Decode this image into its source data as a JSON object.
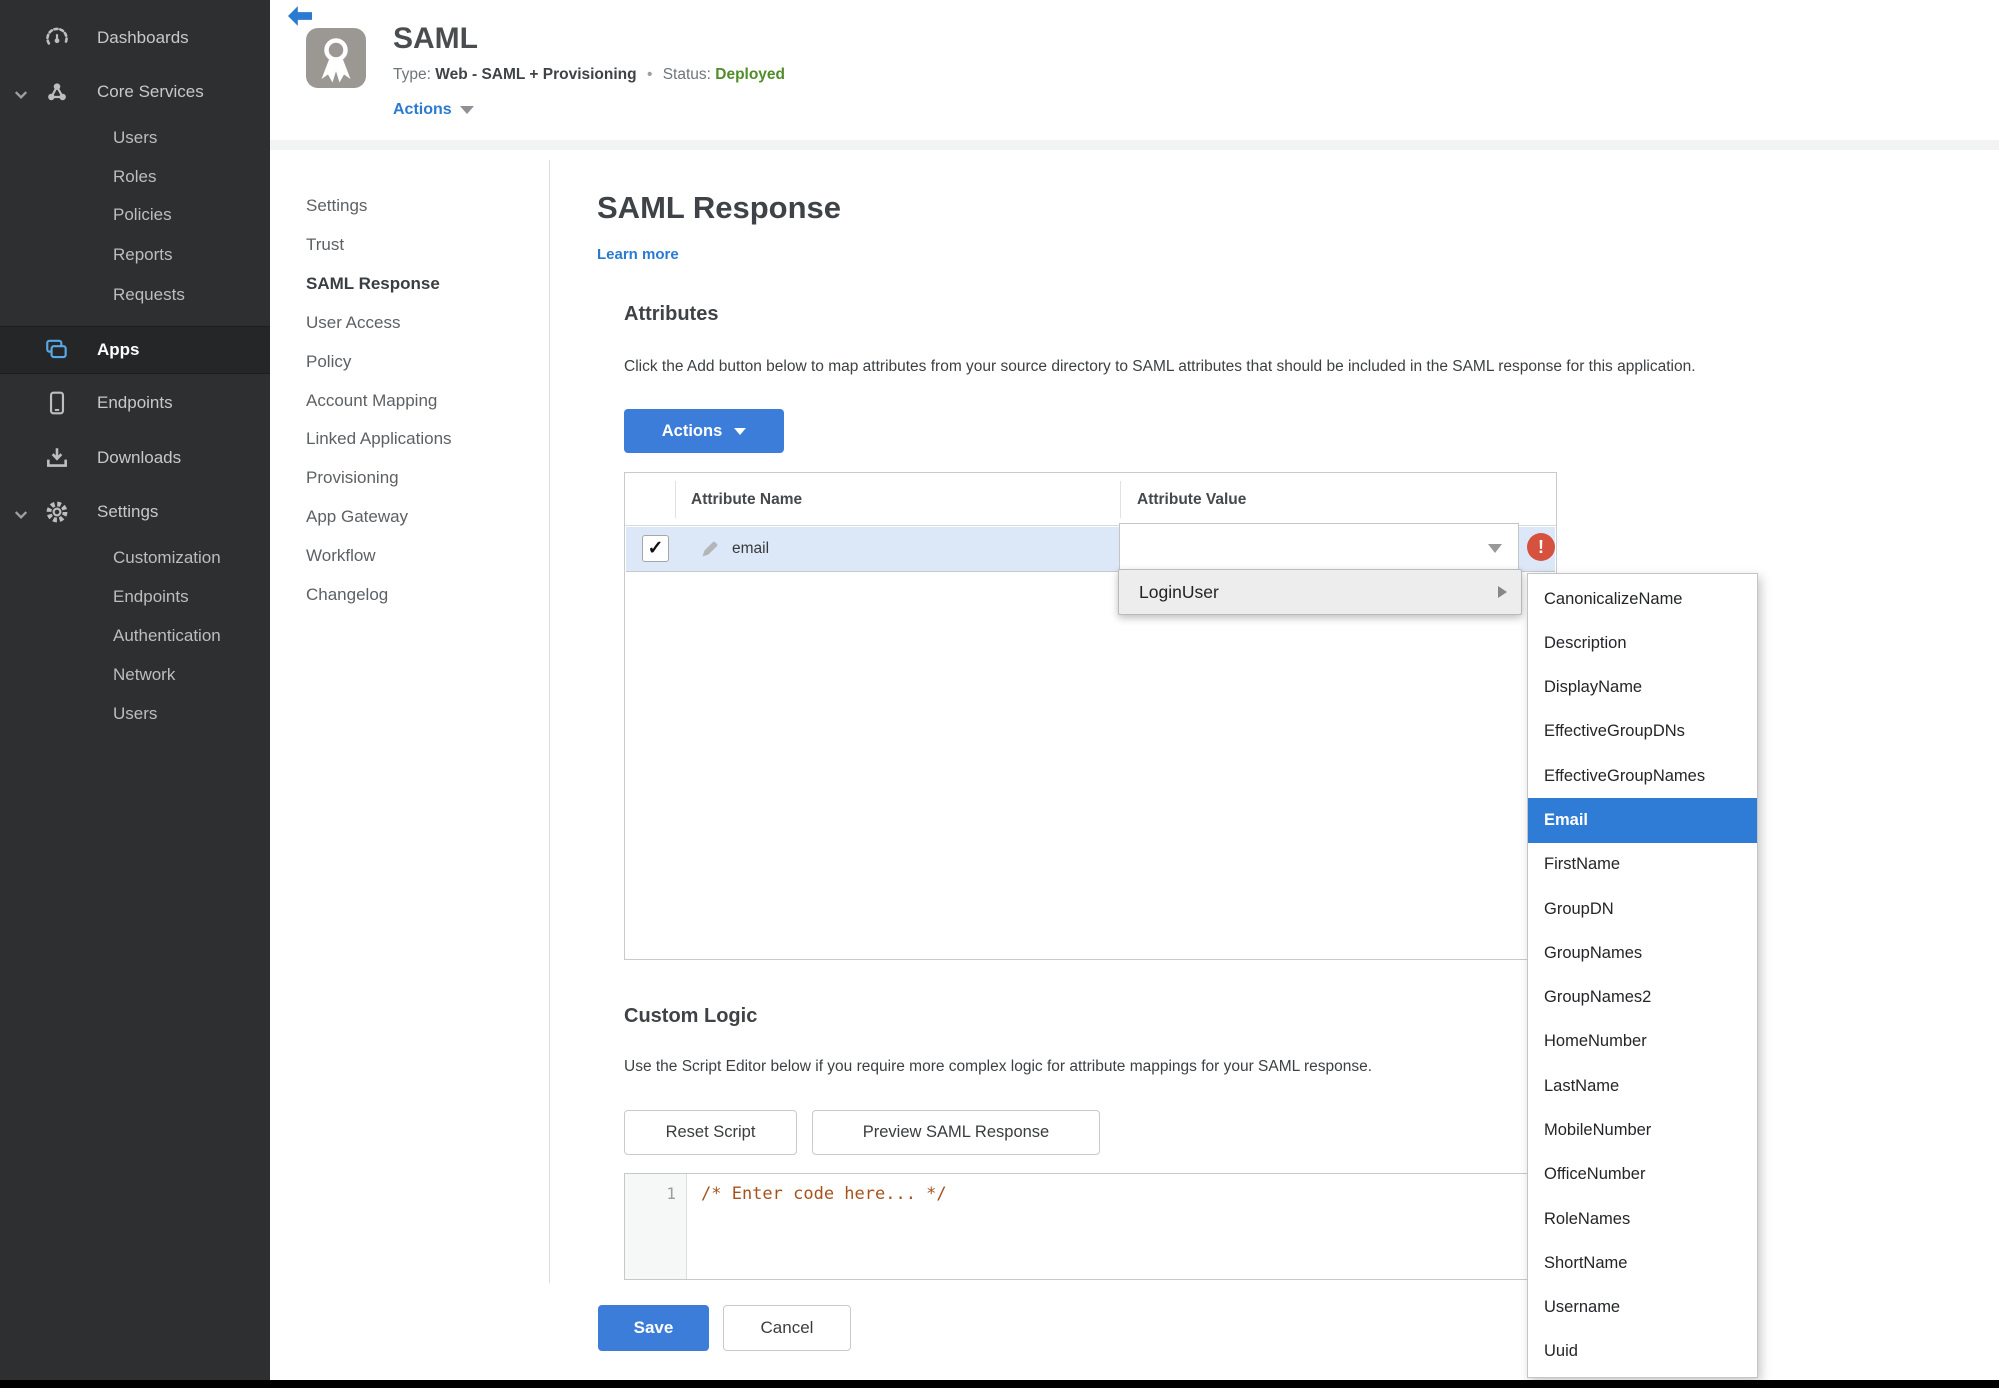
{
  "colors": {
    "accent": "#3b7dd8",
    "link": "#2a7ad2",
    "rowsel": "#dce8f8",
    "highlight": "#2e7cd6",
    "error": "#d6523f",
    "status-green": "#4f8d2a",
    "sidebar-bg": "#2d2f30",
    "sidebar-icon-blue": "#58a8e6",
    "codecomment": "#a6521d"
  },
  "icons": {
    "check": "✓",
    "error": "!"
  },
  "sidebar": {
    "items": [
      {
        "label": "Dashboards"
      },
      {
        "label": "Core Services",
        "expanded": true
      },
      {
        "label": "Users"
      },
      {
        "label": "Roles"
      },
      {
        "label": "Policies"
      },
      {
        "label": "Reports"
      },
      {
        "label": "Requests"
      },
      {
        "label": "Apps",
        "selected": true
      },
      {
        "label": "Endpoints"
      },
      {
        "label": "Downloads"
      },
      {
        "label": "Settings",
        "expanded": true
      },
      {
        "label": "Customization"
      },
      {
        "label": "Endpoints"
      },
      {
        "label": "Authentication"
      },
      {
        "label": "Network"
      },
      {
        "label": "Users"
      }
    ]
  },
  "header": {
    "title": "SAML",
    "type_label": "Type:",
    "type_value": "Web - SAML + Provisioning",
    "separator": "•",
    "status_label": "Status:",
    "status_value": "Deployed",
    "actions_label": "Actions"
  },
  "subnav": {
    "items": [
      {
        "label": "Settings"
      },
      {
        "label": "Trust"
      },
      {
        "label": "SAML Response",
        "active": true
      },
      {
        "label": "User Access"
      },
      {
        "label": "Policy"
      },
      {
        "label": "Account Mapping"
      },
      {
        "label": "Linked Applications"
      },
      {
        "label": "Provisioning"
      },
      {
        "label": "App Gateway"
      },
      {
        "label": "Workflow"
      },
      {
        "label": "Changelog"
      }
    ]
  },
  "main": {
    "title": "SAML Response",
    "learn_more": "Learn more",
    "attributes": {
      "heading": "Attributes",
      "description": "Click the Add button below to map attributes from your source directory to SAML attributes that should be included in the SAML response for this application.",
      "actions_button": "Actions",
      "table": {
        "columns": [
          "Attribute Name",
          "Attribute Value"
        ],
        "rows": [
          {
            "name": "email",
            "value": "",
            "selected": true,
            "error": true
          }
        ]
      }
    },
    "menu": {
      "label": "LoginUser",
      "submenu": {
        "selected": "Email",
        "items": [
          "CanonicalizeName",
          "Description",
          "DisplayName",
          "EffectiveGroupDNs",
          "EffectiveGroupNames",
          "Email",
          "FirstName",
          "GroupDN",
          "GroupNames",
          "GroupNames2",
          "HomeNumber",
          "LastName",
          "MobileNumber",
          "OfficeNumber",
          "RoleNames",
          "ShortName",
          "Username",
          "Uuid"
        ]
      }
    },
    "custom_logic": {
      "heading": "Custom Logic",
      "description": "Use the Script Editor below if you require more complex logic for attribute mappings for your SAML response.",
      "reset_button": "Reset Script",
      "preview_button": "Preview SAML Response",
      "editor": {
        "line_number": "1",
        "code": "/* Enter code here... */"
      }
    },
    "footer": {
      "save": "Save",
      "cancel": "Cancel"
    }
  }
}
